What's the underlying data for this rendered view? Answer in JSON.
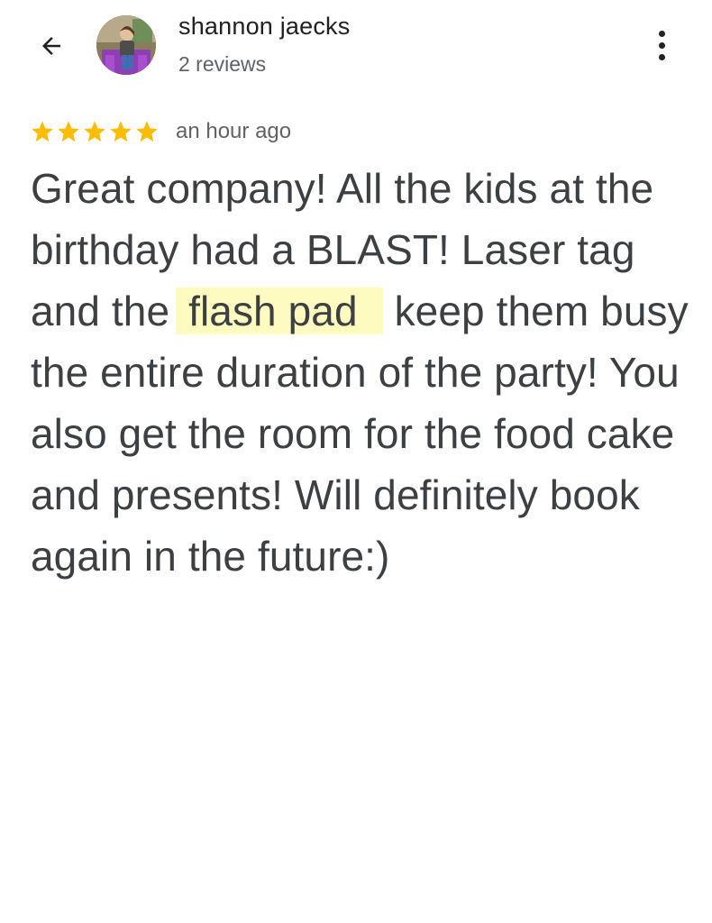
{
  "header": {
    "author_name": "shannon jaecks",
    "review_count": "2 reviews",
    "back_icon": "arrow-back-icon",
    "more_icon": "more-vert-icon"
  },
  "review": {
    "rating": 5,
    "max_rating": 5,
    "star_color": "#fbbc04",
    "timestamp": "an hour ago",
    "text_before_highlight": "Great company! All the kids at the birthday had a BLAST! Laser tag and the",
    "highlighted_text": "flash pad",
    "text_after_highlight": "keep them busy the entire duration of the party! You also get the room for the food cake and presents! Will definitely book again in the future:)",
    "highlight_color": "#fefbc0"
  }
}
